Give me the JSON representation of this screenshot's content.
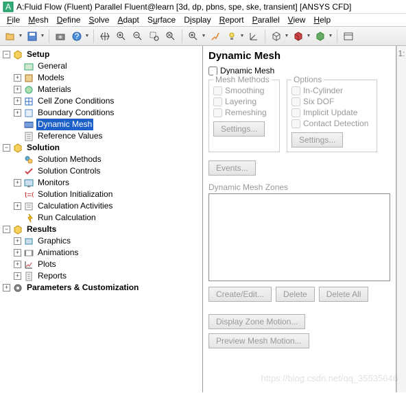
{
  "title": "A:Fluid Flow (Fluent) Parallel Fluent@learn  [3d, dp, pbns, spe, ske, transient] [ANSYS CFD]",
  "menu": [
    "File",
    "Mesh",
    "Define",
    "Solve",
    "Adapt",
    "Surface",
    "Display",
    "Report",
    "Parallel",
    "View",
    "Help"
  ],
  "side_tab": "1:",
  "tree": {
    "setup": "Setup",
    "general": "General",
    "models": "Models",
    "materials": "Materials",
    "czc": "Cell Zone Conditions",
    "bc": "Boundary Conditions",
    "dm": "Dynamic Mesh",
    "ref": "Reference Values",
    "solution": "Solution",
    "sm": "Solution Methods",
    "sc": "Solution Controls",
    "mon": "Monitors",
    "si": "Solution Initialization",
    "ca": "Calculation Activities",
    "run": "Run Calculation",
    "results": "Results",
    "gfx": "Graphics",
    "anim": "Animations",
    "plots": "Plots",
    "reports": "Reports",
    "params": "Parameters & Customization"
  },
  "panel": {
    "title": "Dynamic Mesh",
    "chk": "Dynamic Mesh",
    "mesh_methods": "Mesh Methods",
    "options": "Options",
    "smoothing": "Smoothing",
    "layering": "Layering",
    "remeshing": "Remeshing",
    "in_cyl": "In-Cylinder",
    "six_dof": "Six DOF",
    "impl": "Implicit Update",
    "contact": "Contact Detection",
    "settings": "Settings...",
    "events": "Events...",
    "dmz": "Dynamic Mesh Zones",
    "create": "Create/Edit...",
    "delete": "Delete",
    "delete_all": "Delete All",
    "disp_zone": "Display Zone Motion...",
    "preview": "Preview Mesh Motion..."
  },
  "watermark": "https://blog.csdn.net/qq_35535646"
}
